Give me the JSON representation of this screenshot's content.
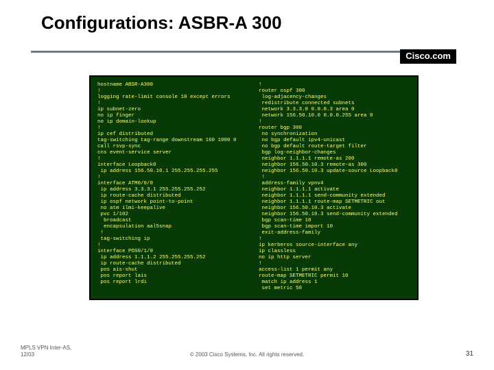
{
  "title": "Configurations: ASBR-A 300",
  "brand": "Cisco.com",
  "config_left": "hostname ABSR-A300\n!\nlogging rate-limit console 10 except errors\n!\nip subnet-zero\nno ip finger\nno ip domain-lookup\n!\nip cef distributed\ntag-switching tag-range downstream 160 1000 0\ncall rsvp-sync\ncns event-service server\n!\ninterface Loopback0\n ip address 156.50.10.1 255.255.255.255\n!\ninterface ATM0/0/0\n ip address 3.3.3.1 255.255.255.252\n ip route-cache distributed\n ip ospf network point-to-point\n no atm ilmi-keepalive\n pvc 1/102\n  broadcast\n  encapsulation aal5snap\n !\n tag-switching ip\n!\ninterface POS0/1/0\n ip address 1.1.1.2 255.255.255.252\n ip route-cache distributed\n pos ais-shut\n pos report lais\n pos report lrdi",
  "config_right": "!\nrouter ospf 300\n log-adjacency-changes\n redistribute connected subnets\n network 3.3.3.0 0.0.0.3 area 0\n network 156.50.10.0 0.0.0.255 area 0\n!\nrouter bgp 300\n no synchronization\n no bgp default ipv4-unicast\n no bgp default route-target filter\n bgp log-neighbor-changes\n neighbor 1.1.1.1 remote-as 200\n neighbor 156.50.10.3 remote-as 300\n neighbor 156.50.10.3 update-source Loopback0\n !\n address-family vpnv4\n neighbor 1.1.1.1 activate\n neighbor 1.1.1.1 send-community extended\n neighbor 1.1.1.1 route-map SETMETRIC out\n neighbor 156.50.10.3 activate\n neighbor 156.50.10.3 send-community extended\n bgp scan-time 10\n bgp scan-time import 10\n exit-address-family\n!\nip kerberos source-interface any\nip classless\nno ip http server\n!\naccess-list 1 permit any\nroute-map SETMETRIC permit 10\n match ip address 1\n set metric 50",
  "footer": {
    "line1": "MPLS VPN Inter-AS,",
    "line2": "12/03",
    "center": "© 2003 Cisco Systems, Inc. All rights reserved.",
    "page": "31"
  }
}
